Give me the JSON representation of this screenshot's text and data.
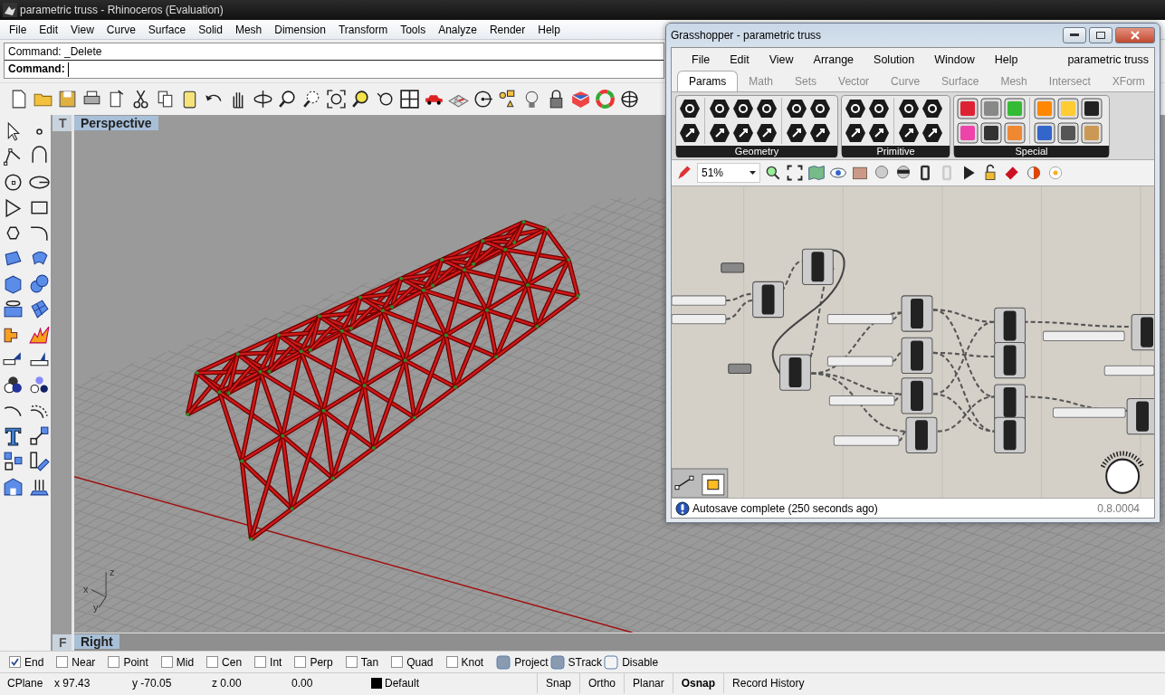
{
  "rhino": {
    "title": "parametric truss - Rhinoceros (Evaluation)",
    "menu": [
      "File",
      "Edit",
      "View",
      "Curve",
      "Surface",
      "Solid",
      "Mesh",
      "Dimension",
      "Transform",
      "Tools",
      "Analyze",
      "Render",
      "Help"
    ],
    "command_history": "Command: _Delete",
    "command_prompt": "Command:",
    "viewport_tabs_top": [
      {
        "label": "T",
        "selected": false
      },
      {
        "label": "Perspective",
        "selected": true
      }
    ],
    "viewport_tabs_bottom": [
      {
        "label": "F",
        "selected": false
      },
      {
        "label": "Right",
        "selected": true
      }
    ],
    "axis_labels": {
      "z": "z",
      "x": "x",
      "y": "y"
    }
  },
  "osnaps": [
    {
      "label": "End",
      "checked": true,
      "kind": "check"
    },
    {
      "label": "Near",
      "checked": false,
      "kind": "check"
    },
    {
      "label": "Point",
      "checked": false,
      "kind": "check"
    },
    {
      "label": "Mid",
      "checked": false,
      "kind": "check"
    },
    {
      "label": "Cen",
      "checked": false,
      "kind": "check"
    },
    {
      "label": "Int",
      "checked": false,
      "kind": "check"
    },
    {
      "label": "Perp",
      "checked": false,
      "kind": "check"
    },
    {
      "label": "Tan",
      "checked": false,
      "kind": "check"
    },
    {
      "label": "Quad",
      "checked": false,
      "kind": "check"
    },
    {
      "label": "Knot",
      "checked": false,
      "kind": "check"
    },
    {
      "label": "Project",
      "checked": false,
      "kind": "toggle"
    },
    {
      "label": "STrack",
      "checked": false,
      "kind": "toggle"
    },
    {
      "label": "Disable",
      "checked": false,
      "kind": "toggle"
    }
  ],
  "status_bar": {
    "cplane": "CPlane",
    "x": "x 97.43",
    "y": "y -70.05",
    "z": "z 0.00",
    "distance": "0.00",
    "layer": "Default",
    "panes": [
      {
        "label": "Snap",
        "on": false
      },
      {
        "label": "Ortho",
        "on": false
      },
      {
        "label": "Planar",
        "on": false
      },
      {
        "label": "Osnap",
        "on": true
      },
      {
        "label": "Record History",
        "on": false
      }
    ]
  },
  "grasshopper": {
    "title": "Grasshopper - parametric truss",
    "menu": [
      "File",
      "Edit",
      "View",
      "Arrange",
      "Solution",
      "Window",
      "Help"
    ],
    "document": "parametric truss",
    "tabs": [
      {
        "label": "Params",
        "selected": true
      },
      {
        "label": "Math",
        "selected": false
      },
      {
        "label": "Sets",
        "selected": false
      },
      {
        "label": "Vector",
        "selected": false
      },
      {
        "label": "Curve",
        "selected": false
      },
      {
        "label": "Surface",
        "selected": false
      },
      {
        "label": "Mesh",
        "selected": false
      },
      {
        "label": "Intersect",
        "selected": false
      },
      {
        "label": "XForm",
        "selected": false
      }
    ],
    "panels": [
      {
        "name": "Geometry",
        "kind": "hex"
      },
      {
        "name": "Primitive",
        "kind": "hex"
      },
      {
        "name": "Special",
        "kind": "tile"
      }
    ],
    "zoom": "51%",
    "status": "Autosave complete (250 seconds ago)",
    "version": "0.8.0004"
  }
}
